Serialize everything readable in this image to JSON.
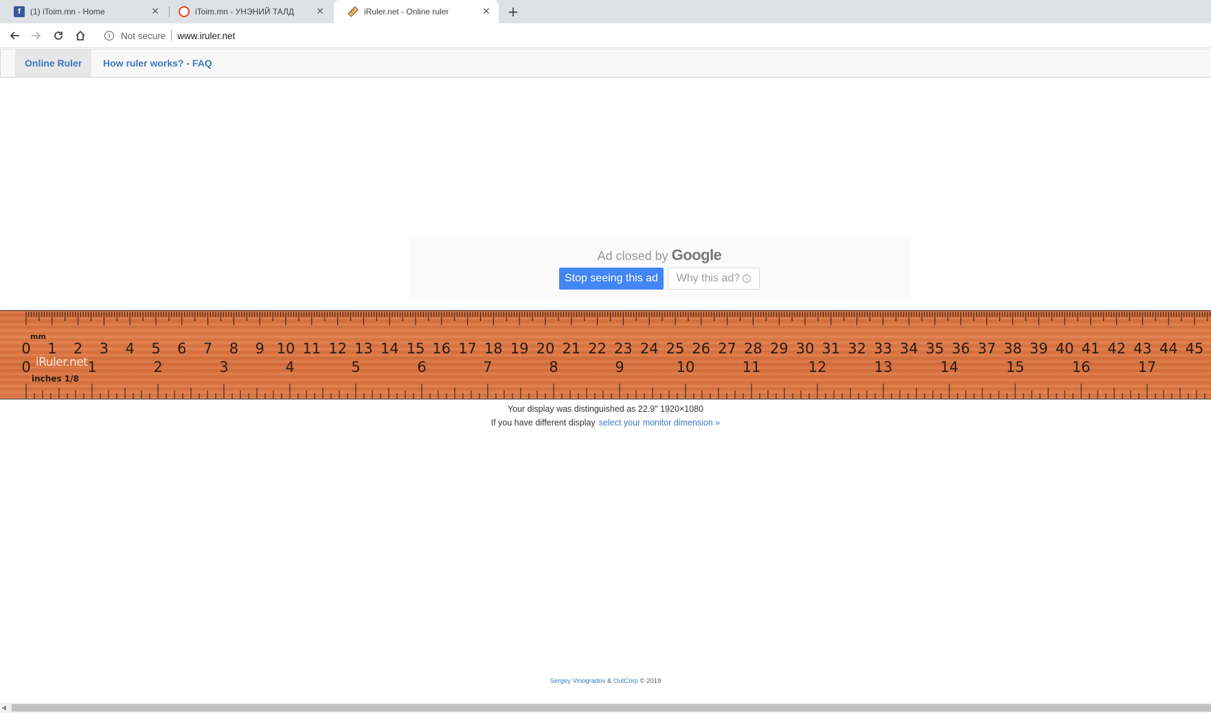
{
  "browser": {
    "tabs": [
      {
        "title": "(1) iToim.mn - Home",
        "icon": "facebook-icon",
        "active": false
      },
      {
        "title": "iToim.mn - УНЭНИЙ ТАЛД",
        "icon": "itoim-icon",
        "active": false
      },
      {
        "title": "iRuler.net - Online ruler",
        "icon": "ruler-icon",
        "active": true
      }
    ],
    "new_tab_label": "+",
    "close_glyph": "✕",
    "omnibox": {
      "security_label": "Not secure",
      "url": "www.iruler.net"
    }
  },
  "site_nav": {
    "items": [
      {
        "label": "Online Ruler",
        "active": true
      },
      {
        "label": "How ruler works? - FAQ",
        "active": false
      }
    ]
  },
  "ad": {
    "closed_prefix": "Ad closed by",
    "closed_brand": "Google",
    "stop_label": "Stop seeing this ad",
    "why_label": "Why this ad?",
    "info_glyph": "i"
  },
  "ruler": {
    "brand": "iRuler.net",
    "mm_unit": "mm",
    "inch_unit": "inches 1/8",
    "cm_labels": [
      "0",
      "1",
      "2",
      "3",
      "4",
      "5",
      "6",
      "7",
      "8",
      "9",
      "10",
      "11",
      "12",
      "13",
      "14",
      "15",
      "16",
      "17",
      "18",
      "19",
      "20",
      "21",
      "22",
      "23",
      "24",
      "25",
      "26",
      "27",
      "28",
      "29",
      "30",
      "31",
      "32",
      "33",
      "34",
      "35",
      "36",
      "37",
      "38",
      "39",
      "40",
      "41",
      "42",
      "43",
      "44",
      "45"
    ],
    "inch_labels": [
      "0",
      "1",
      "2",
      "3",
      "4",
      "5",
      "6",
      "7",
      "8",
      "9",
      "10",
      "11",
      "12",
      "13",
      "14",
      "15",
      "16",
      "17"
    ],
    "colors": {
      "wood": "#de7a45",
      "ink": "#2a1b14",
      "brand": "#ffe8dc"
    }
  },
  "display": {
    "detected_text": "Your display was distinguished as 22.9\" 1920×1080",
    "different_prefix": "If you have different display",
    "select_link": "select your monitor dimension »"
  },
  "footer": {
    "author": "Sergey Vinogradov",
    "amp": " & ",
    "company": "OutCorp",
    "copyright": " © 2019"
  }
}
